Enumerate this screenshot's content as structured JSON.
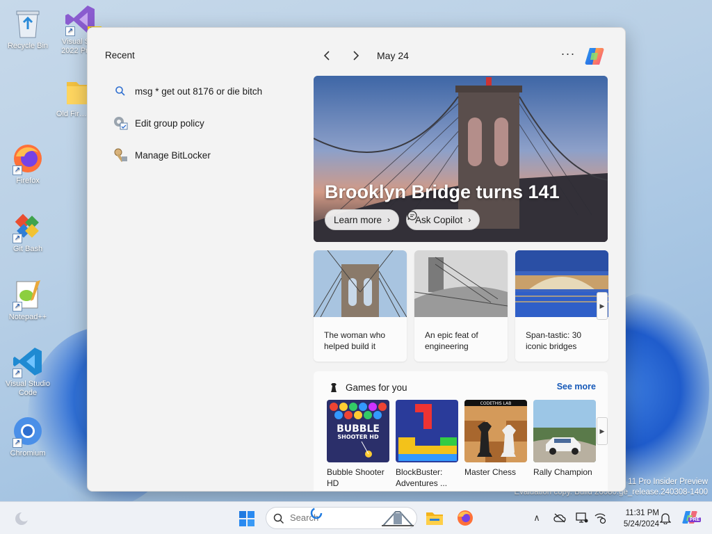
{
  "desktop": {
    "icons": [
      {
        "label": "Recycle Bin"
      },
      {
        "label": "Visual Studio 2022 Preview",
        "display": "Visual St… 2022 Pre…",
        "badge": "PR"
      },
      {
        "label": "Old Firefox Data",
        "display": "Old Fir… Data"
      },
      {
        "label": "Firefox"
      },
      {
        "label": "Git Bash"
      },
      {
        "label": "Notepad++"
      },
      {
        "label": "Visual Studio Code"
      },
      {
        "label": "Chromium"
      }
    ],
    "watermark_line1": "11 Pro Insider Preview",
    "watermark_line2": "Evaluation copy. Build 26080.ge_release.240308-1400"
  },
  "panel": {
    "recent_title": "Recent",
    "recent": [
      {
        "label": "msg * get out 8176 or die bitch",
        "icon": "search-icon"
      },
      {
        "label": "Edit group policy",
        "icon": "group-policy-icon"
      },
      {
        "label": "Manage BitLocker",
        "icon": "bitlocker-icon"
      }
    ],
    "date": "May 24",
    "more_label": "···",
    "hero": {
      "title": "Brooklyn Bridge turns 141",
      "learn_more": "Learn more",
      "ask_copilot": "Ask Copilot"
    },
    "cards": [
      {
        "text": "The woman who helped build it"
      },
      {
        "text": "An epic feat of engineering"
      },
      {
        "text": "Span-tastic: 30 iconic bridges"
      }
    ],
    "games": {
      "title": "Games for you",
      "see_more": "See more",
      "items": [
        {
          "name": "Bubble Shooter HD",
          "thumb_text": "BUBBLE SHOOTER HD"
        },
        {
          "name": "BlockBuster: Adventures ..."
        },
        {
          "name": "Master Chess",
          "thumb_text": "CODETHIS LAB"
        },
        {
          "name": "Rally Champion"
        }
      ]
    }
  },
  "taskbar": {
    "search_placeholder": "Search",
    "time": "11:31 PM",
    "date": "5/24/2024",
    "tray_badge": "PRE"
  },
  "colors": {
    "accent": "#1659b8",
    "panel_bg": "#f3f3f3",
    "taskbar_bg": "#eef1f6"
  }
}
